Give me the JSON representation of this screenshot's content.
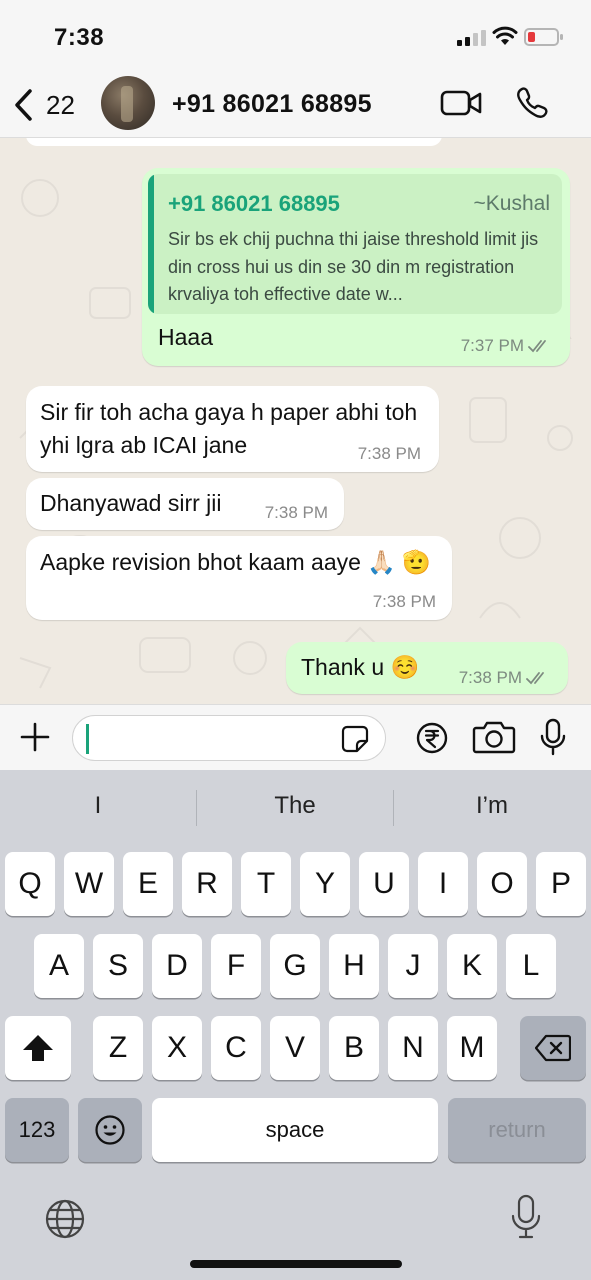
{
  "status_bar": {
    "time": "7:38",
    "icons": [
      "signal-icon",
      "wifi-icon",
      "battery-icon"
    ],
    "battery_color": "#e5393c"
  },
  "header": {
    "back_count": "22",
    "contact_name": "+91 86021 68895",
    "icons": [
      "back-chevron-icon",
      "avatar",
      "video-call-icon",
      "phone-call-icon"
    ]
  },
  "chat": {
    "messages": [
      {
        "direction": "outgoing",
        "quoted": {
          "number": "+91 86021 68895",
          "author": "~Kushal",
          "text": "Sir bs ek chij puchna thi jaise threshold limit jis din cross hui us din se 30 din m registration krvaliya toh effective date w..."
        },
        "text": "Haaa",
        "time": "7:37 PM",
        "status": "read"
      },
      {
        "direction": "incoming",
        "text": "Sir fir toh acha gaya h paper abhi toh yhi lgra ab ICAI jane",
        "time": "7:38 PM"
      },
      {
        "direction": "incoming",
        "text": "Dhanyawad sirr jii",
        "time": "7:38 PM"
      },
      {
        "direction": "incoming",
        "text": "Aapke revision bhot kaam aaye 🙏🏻 🫡",
        "time": "7:38 PM"
      },
      {
        "direction": "outgoing",
        "text": "Thank u ☺️",
        "time": "7:38 PM",
        "status": "read"
      }
    ],
    "bubble_colors": {
      "outgoing": "#d9fdd3",
      "incoming": "#ffffff",
      "accent": "#1aa37a"
    }
  },
  "input_bar": {
    "value": "",
    "icons": [
      "plus-icon",
      "sticker-icon",
      "rupee-payment-icon",
      "camera-icon",
      "microphone-icon"
    ]
  },
  "keyboard": {
    "suggestions": [
      "I",
      "The",
      "I’m"
    ],
    "row1": [
      "Q",
      "W",
      "E",
      "R",
      "T",
      "Y",
      "U",
      "I",
      "O",
      "P"
    ],
    "row2": [
      "A",
      "S",
      "D",
      "F",
      "G",
      "H",
      "J",
      "K",
      "L"
    ],
    "row3": [
      "Z",
      "X",
      "C",
      "V",
      "B",
      "N",
      "M"
    ],
    "numbers_label": "123",
    "space_label": "space",
    "return_label": "return",
    "icons": [
      "shift-icon",
      "backspace-icon",
      "emoji-icon",
      "globe-icon",
      "dictation-mic-icon"
    ]
  }
}
